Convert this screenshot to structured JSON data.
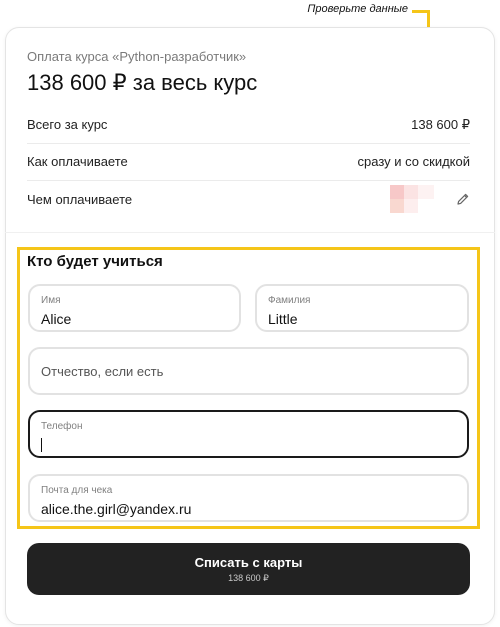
{
  "callout": {
    "text": "Проверьте данные"
  },
  "summary": {
    "course_label": "Оплата курса «Python-разработчик»",
    "price_headline": "138 600 ₽ за весь курс",
    "rows": [
      {
        "label": "Всего за курс",
        "value": "138 600 ₽"
      },
      {
        "label": "Как оплачиваете",
        "value": "сразу и со скидкой"
      },
      {
        "label": "Чем оплачиваете",
        "value": ""
      }
    ]
  },
  "form": {
    "title": "Кто будет учиться",
    "first_name": {
      "label": "Имя",
      "value": "Alice"
    },
    "last_name": {
      "label": "Фамилия",
      "value": "Little"
    },
    "middle_name": {
      "placeholder": "Отчество, если есть"
    },
    "phone": {
      "label": "Телефон",
      "value": ""
    },
    "email": {
      "label": "Почта для чека",
      "value": "alice.the.girl@yandex.ru"
    }
  },
  "pay_button": {
    "label": "Списать с карты",
    "amount": "138 600 ₽"
  },
  "colors": {
    "highlight": "#f5c518",
    "button_bg": "#222222",
    "focus_border": "#1a1a1a"
  },
  "icons": {
    "edit_payment": "pencil-icon"
  }
}
